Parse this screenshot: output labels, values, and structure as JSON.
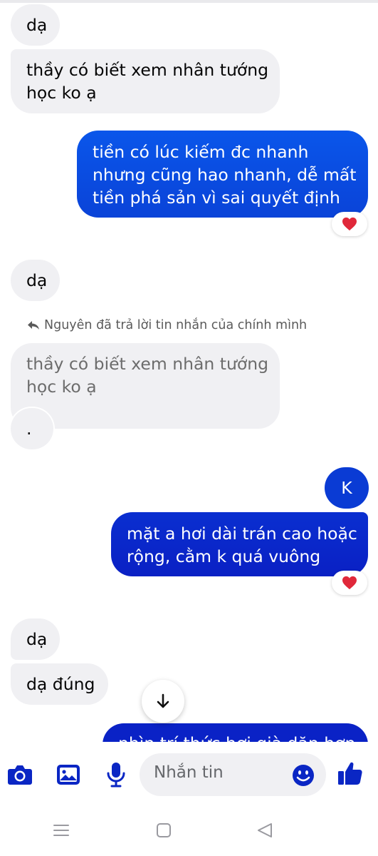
{
  "colors": {
    "incoming_bg": "#f0f0f3",
    "outgoing_gradient_top": "#0a50e6",
    "outgoing_gradient_bottom": "#0a1fc8",
    "icon_blue": "#0a26c4",
    "heart": "#e0283a"
  },
  "messages": [
    {
      "id": 1,
      "side": "incoming",
      "lines": [
        "dạ"
      ]
    },
    {
      "id": 2,
      "side": "incoming",
      "lines": [
        "thầy có biết xem nhân tướng",
        "học ko ạ"
      ]
    },
    {
      "id": 3,
      "side": "outgoing",
      "lines": [
        "tiền có lúc kiếm đc nhanh",
        "nhưng cũng hao nhanh, dễ mất",
        "tiền phá sản vì sai quyết định"
      ],
      "reaction": "heart-icon"
    },
    {
      "id": 4,
      "side": "incoming",
      "lines": [
        "dạ"
      ]
    },
    {
      "id": 5,
      "side": "incoming",
      "reply_note": "Nguyên đã trả lời tin nhắn của chính mình",
      "quoted_lines": [
        "thầy có biết xem nhân tướng",
        "học ko ạ"
      ],
      "lines": [
        "."
      ]
    },
    {
      "id": 6,
      "side": "outgoing",
      "lines": [
        "K"
      ]
    },
    {
      "id": 7,
      "side": "outgoing",
      "lines": [
        "mặt a hơi dài trán cao hoặc",
        "rộng, cằm k quá vuông"
      ],
      "reaction": "heart-icon"
    },
    {
      "id": 8,
      "side": "incoming",
      "lines": [
        "dạ"
      ]
    },
    {
      "id": 9,
      "side": "incoming",
      "lines": [
        "dạ đúng"
      ]
    },
    {
      "id": 10,
      "side": "outgoing",
      "lines": [
        "nhìn trí thức hơi già dặn hơn"
      ],
      "partially_hidden": true
    }
  ],
  "scroll_down_icon": "arrow-down-icon",
  "composer": {
    "camera_icon": "camera-icon",
    "gallery_icon": "image-icon",
    "mic_icon": "microphone-icon",
    "placeholder": "Nhắn tin",
    "emoji_icon": "emoji-icon",
    "like_icon": "thumbs-up-icon"
  },
  "navbar": {
    "menu_icon": "menu-icon",
    "home_icon": "home-square-icon",
    "back_icon": "back-triangle-icon"
  }
}
